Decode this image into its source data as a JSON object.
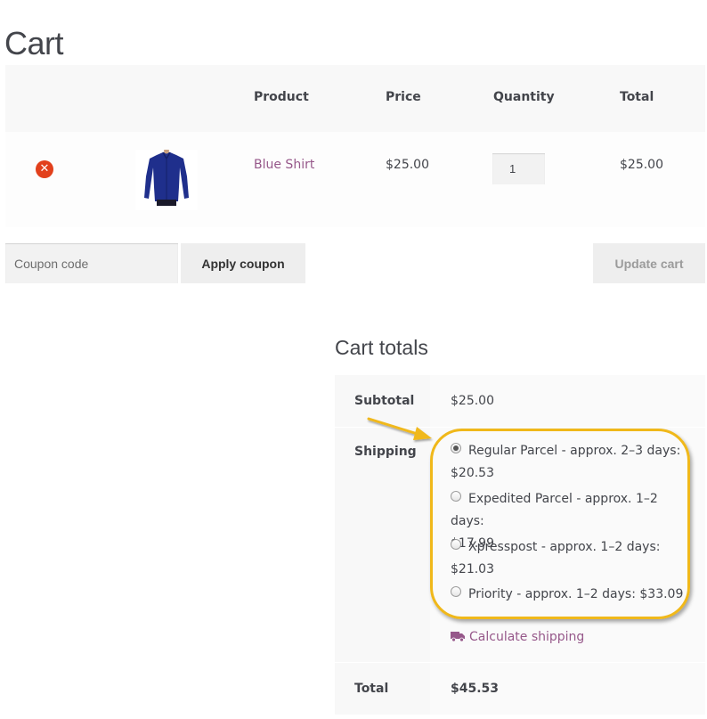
{
  "page": {
    "title": "Cart"
  },
  "cart_table": {
    "headers": {
      "product": "Product",
      "price": "Price",
      "quantity": "Quantity",
      "total": "Total"
    },
    "rows": [
      {
        "product": "Blue Shirt",
        "price": "$25.00",
        "quantity": "1",
        "total": "$25.00",
        "thumbnail": "blue-shirt-image"
      }
    ]
  },
  "actions": {
    "coupon_placeholder": "Coupon code",
    "apply_coupon": "Apply coupon",
    "update_cart": "Update cart"
  },
  "cart_totals": {
    "title": "Cart totals",
    "subtotal_label": "Subtotal",
    "subtotal_value": "$25.00",
    "shipping_label": "Shipping",
    "shipping_options": [
      {
        "line1": "Regular Parcel - approx. 2–3 days:",
        "line2": "$20.53",
        "selected": true
      },
      {
        "line1": "Expedited Parcel - approx. 1–2 days:",
        "line2": "$17.99",
        "selected": false
      },
      {
        "line1": "Xpresspost - approx. 1–2 days:",
        "line2": "$21.03",
        "selected": false
      },
      {
        "line1": "Priority - approx. 1–2 days: $33.09",
        "line2": "",
        "selected": false
      }
    ],
    "calculate_shipping": "Calculate shipping",
    "total_label": "Total",
    "total_value": "$45.53"
  },
  "colors": {
    "link": "#96588a",
    "remove": "#e2401c",
    "highlight": "#f0b81a"
  },
  "icons": {
    "remove": "remove-x-icon",
    "truck": "truck-icon",
    "arrow": "annotation-arrow"
  }
}
